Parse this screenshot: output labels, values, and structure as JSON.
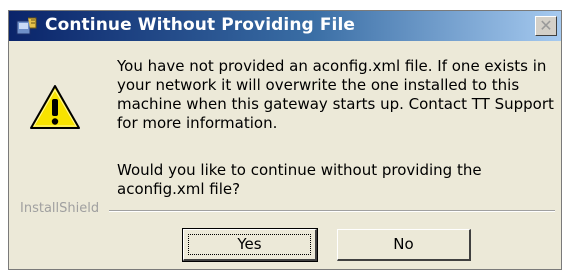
{
  "window": {
    "title": "Continue Without Providing File",
    "close_glyph": "✕"
  },
  "message": {
    "body": "You have not provided an aconfig.xml file. If one exists in your network it will overwrite the one installed to this machine when this gateway starts up. Contact TT Support for more information.",
    "question": "Would you like to continue without providing the aconfig.xml file?"
  },
  "footer": {
    "brand": "InstallShield"
  },
  "buttons": {
    "yes_label": "Yes",
    "no_label": "No"
  },
  "icons": {
    "title": "installer-app-icon",
    "warning": "warning-icon"
  }
}
